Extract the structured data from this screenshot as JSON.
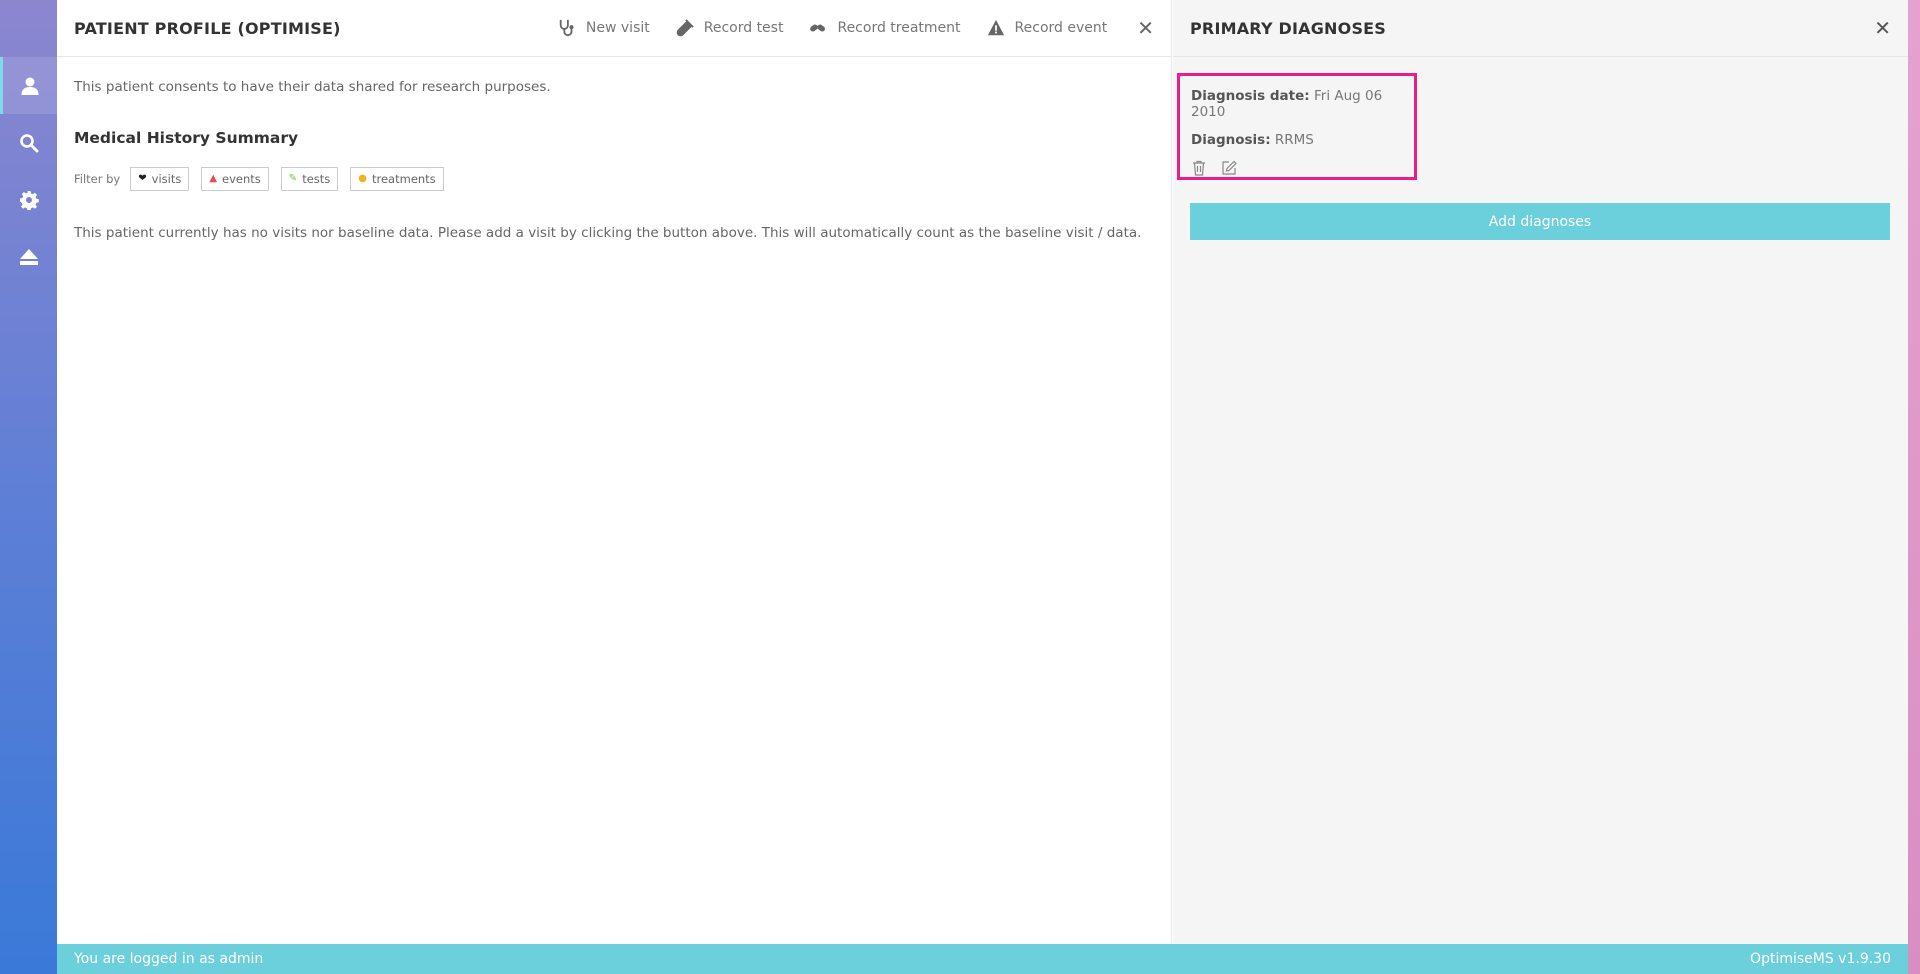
{
  "nav": {
    "items": [
      {
        "icon": "user-icon",
        "active": true
      },
      {
        "icon": "search-icon"
      },
      {
        "icon": "gear-icon"
      },
      {
        "icon": "eject-icon"
      }
    ]
  },
  "main": {
    "title": "PATIENT PROFILE (OPTIMISE)",
    "actions": {
      "new_visit": "New visit",
      "record_test": "Record test",
      "record_treatment": "Record treatment",
      "record_event": "Record event"
    },
    "close": "✕",
    "consent_text": "This patient consents to have their data shared for research purposes.",
    "section_title": "Medical History Summary",
    "filter": {
      "label": "Filter by",
      "chips": [
        {
          "label": "visits",
          "icon": "heart-icon",
          "color": "#222222"
        },
        {
          "label": "events",
          "icon": "warning-icon",
          "color": "#e64c4c"
        },
        {
          "label": "tests",
          "icon": "test-icon",
          "color": "#6cbf3c"
        },
        {
          "label": "treatments",
          "icon": "pill-icon",
          "color": "#f0b323"
        }
      ]
    },
    "no_data_text": "This patient currently has no visits nor baseline data. Please add a visit by clicking the button above. This will automatically count as the baseline visit / data."
  },
  "side": {
    "title": "PRIMARY DIAGNOSES",
    "close": "✕",
    "diagnosis_date_label": "Diagnosis date:",
    "diagnosis_date_value": "Fri Aug 06 2010",
    "diagnosis_label": "Diagnosis:",
    "diagnosis_value": "RRMS",
    "add_button": "Add diagnoses",
    "highlight_color": "#e91e8c"
  },
  "footer": {
    "login_text": "You are logged in as admin",
    "version": "OptimiseMS v1.9.30"
  },
  "colors": {
    "accent": "#6bcfdc",
    "nav_top": "#8c86cf",
    "nav_bottom": "#3a79d8"
  }
}
